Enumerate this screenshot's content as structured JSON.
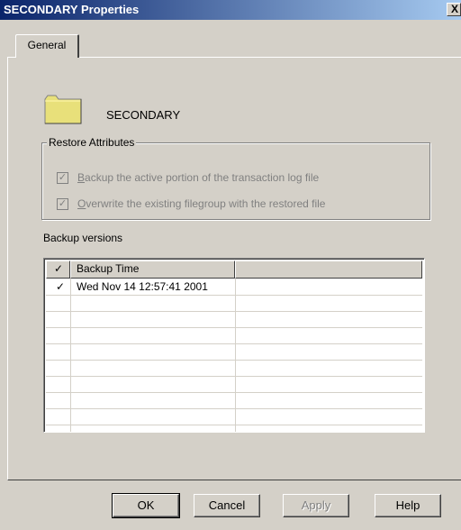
{
  "window": {
    "title": "SECONDARY Properties",
    "close_glyph": "X"
  },
  "tabs": [
    {
      "label": "General"
    }
  ],
  "filegroup": {
    "name": "SECONDARY",
    "icon": "folder-icon"
  },
  "restore_attributes": {
    "label": "Restore Attributes",
    "options": [
      {
        "mnemonic": "B",
        "rest": "ackup the active portion of the transaction log file",
        "checked": true,
        "enabled": false
      },
      {
        "mnemonic": "O",
        "rest": "verwrite the existing filegroup with the restored file",
        "checked": true,
        "enabled": false
      }
    ]
  },
  "backup_versions": {
    "label": "Backup versions",
    "columns": [
      "✓",
      "Backup Time",
      ""
    ],
    "rows": [
      {
        "check": "✓",
        "time": "Wed Nov 14 12:57:41 2001",
        "extra": ""
      }
    ]
  },
  "buttons": {
    "ok": "OK",
    "cancel": "Cancel",
    "apply": "Apply",
    "help": "Help"
  },
  "colors": {
    "titlebar_start": "#0a246a",
    "titlebar_end": "#a6caf0",
    "face": "#d4d0c8",
    "folder": "#e8e07a"
  }
}
